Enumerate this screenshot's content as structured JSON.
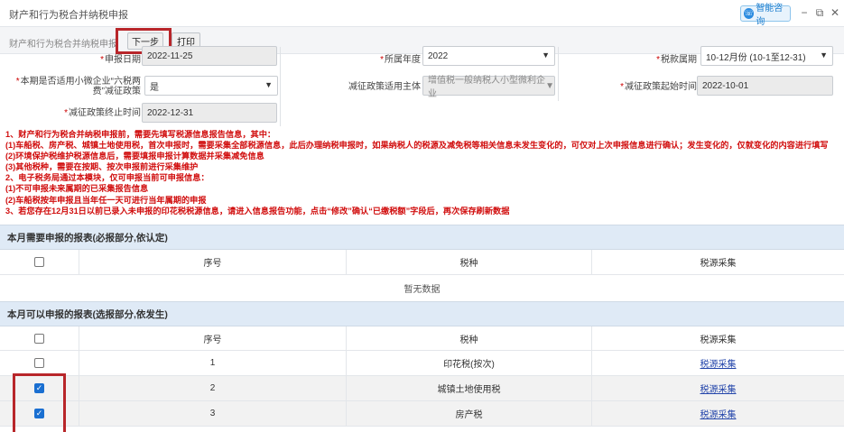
{
  "window": {
    "title": "财产和行为税合并纳税申报",
    "assist_label": "智能咨询",
    "minimize_icon": "minimize-icon",
    "maximize_icon": "maximize-icon",
    "close_icon": "close-icon"
  },
  "toolbar": {
    "breadcrumb": "财产和行为税合并纳税申报",
    "next_label": "下一步",
    "print_label": "打印"
  },
  "form": {
    "declare_date_label": "申报日期",
    "declare_date_value": "2022-11-25",
    "year_label": "所属年度",
    "year_value": "2022",
    "period_label": "税款属期",
    "period_value": "10-12月份 (10-1至12-31)",
    "small_biz_label": "本期是否适用小微企业“六税两费”减征政策",
    "small_biz_value": "是",
    "subject_label": "减征政策适用主体",
    "subject_value": "增值税一般纳税人小型微利企业",
    "start_label": "减征政策起始时间",
    "start_value": "2022-10-01",
    "end_label": "减征政策终止时间",
    "end_value": "2022-12-31"
  },
  "notice": {
    "lines": [
      "1、财产和行为税合并纳税申报前，需要先填写税源信息报告信息，其中：",
      "(1)车船税、房产税、城镇土地使用税，首次申报时，需要采集全部税源信息，此后办理纳税申报时，如果纳税人的税源及减免税等相关信息未发生变化的，可仅对上次申报信息进行确认；发生变化的，仅就变化的内容进行填写",
      "(2)环境保护税维护税源信息后，需要填报申报计算数据并采集减免信息",
      "(3)其他税种，需要在按期、按次申报前进行采集维护",
      "2、电子税务局通过本模块，仅可申报当前可申报信息：",
      "(1)不可申报未来属期的已采集报告信息",
      "(2)车船税按年申报且当年任一天可进行当年属期的申报",
      "3、若您存在12月31日以前已录入未申报的印花税税源信息，请进入信息报告功能，点击“修改”确认“已缴税额”字段后，再次保存刷新数据"
    ]
  },
  "required_section": {
    "title": "本月需要申报的报表(必报部分,依认定)",
    "headers": [
      "序号",
      "税种",
      "税源采集"
    ],
    "empty_text": "暂无数据"
  },
  "optional_section": {
    "title": "本月可以申报的报表(选报部分,依发生)",
    "headers": [
      "序号",
      "税种",
      "税源采集"
    ],
    "rows": [
      {
        "index": "1",
        "tax": "印花税(按次)",
        "link": "税源采集",
        "checked": false
      },
      {
        "index": "2",
        "tax": "城镇土地使用税",
        "link": "税源采集",
        "checked": true
      },
      {
        "index": "3",
        "tax": "房产税",
        "link": "税源采集",
        "checked": true
      }
    ]
  },
  "colors": {
    "highlight_border": "#b8262a",
    "notice_text": "#d10f0f",
    "section_bg": "#dfeaf6",
    "link": "#2244aa"
  }
}
